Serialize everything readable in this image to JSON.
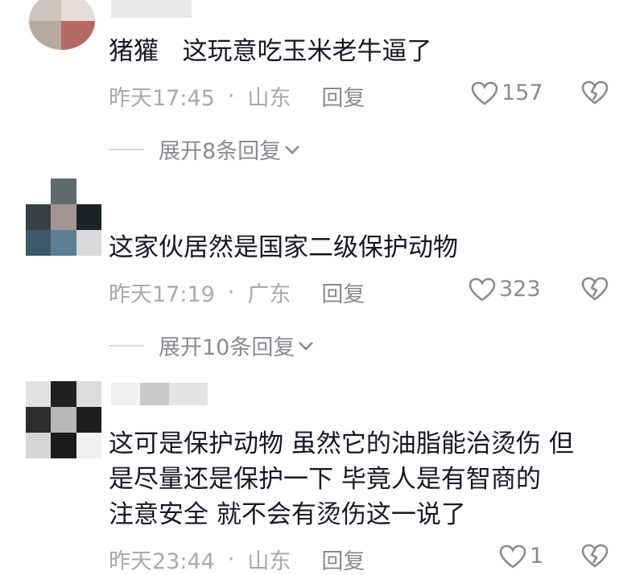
{
  "top_cut_text": "······",
  "comments": [
    {
      "username": "猪獾",
      "text_lines": [
        "这玩意吃玉米老牛逼了"
      ],
      "time": "昨天17:45",
      "location": "山东",
      "reply_label": "回复",
      "likes": "157",
      "expand_label": "展开8条回复"
    },
    {
      "username": "",
      "text_lines": [
        "这家伙居然是国家二级保护动物"
      ],
      "time": "昨天17:19",
      "location": "广东",
      "reply_label": "回复",
      "likes": "323",
      "expand_label": "展开10条回复"
    },
    {
      "username": "",
      "text_lines": [
        "这可是保护动物  虽然它的油脂能治烫伤 但",
        "是尽量还是保护一下  毕竟人是有智商的",
        "注意安全  就不会有烫伤这一说了"
      ],
      "time": "昨天23:44",
      "location": "山东",
      "reply_label": "回复",
      "likes": "1",
      "expand_label": ""
    }
  ],
  "separator": "·",
  "icons": {
    "like": "heart-outline-icon",
    "dislike": "broken-heart-icon",
    "expand": "chevron-down-icon"
  },
  "colors": {
    "text": "#161823",
    "meta": "#a9a9ae",
    "action": "#8a8b91"
  }
}
